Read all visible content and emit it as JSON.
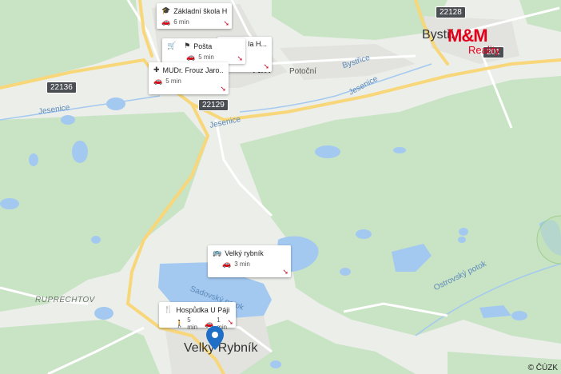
{
  "map": {
    "place_labels": {
      "bystrice": "Bystři",
      "hora": "rtín",
      "velky_rybnik": "Velký Rybník",
      "ruprechtov": "RUPRECHTOV"
    },
    "road_labels": [
      "22128",
      "22136",
      "22129",
      "201"
    ],
    "street_labels": {
      "potocni": "Potoční",
      "bystrice_stream": "Bystřice",
      "jesenice_1": "Jesenice",
      "jesenice_2": "Jesenice",
      "jesenice_3": "Jesenice",
      "sadovsky_potok": "Sadovský potok",
      "ostrovsky_potok": "Ostrovský potok"
    },
    "colors": {
      "land": "#eceeea",
      "forest": "#c9e3c5",
      "water": "#a3c9f0",
      "major_road": "#f8d77a",
      "minor_road": "#ffffff",
      "pin": "#1f6fc6"
    },
    "copyright": "© ČÚZK"
  },
  "brand": {
    "logo_text": "M&M",
    "logo_subtext": "Reality"
  },
  "pois": [
    {
      "name": "Základní škola Hr...",
      "icon": "school-icon",
      "times": [
        {
          "mode": "car-icon",
          "value": "6 min"
        }
      ]
    },
    {
      "name": "Pošta",
      "icon": "post-office-icon",
      "times": [
        {
          "mode": "car-icon",
          "value": "5 min"
        }
      ]
    },
    {
      "name": "la H...",
      "icon": "shop-icon",
      "times": []
    },
    {
      "name": "MUDr. Frouz Jaro...",
      "icon": "medical-icon",
      "times": [
        {
          "mode": "car-icon",
          "value": "5 min"
        }
      ]
    },
    {
      "name": "Velký rybník",
      "icon": "bus-icon",
      "times": [
        {
          "mode": "car-icon",
          "value": "3 min"
        }
      ]
    },
    {
      "name": "Hospůdka U Páji",
      "icon": "restaurant-icon",
      "times": [
        {
          "mode": "walk-icon",
          "value": "5 min"
        },
        {
          "mode": "car-icon",
          "value": "1 min"
        }
      ]
    }
  ]
}
